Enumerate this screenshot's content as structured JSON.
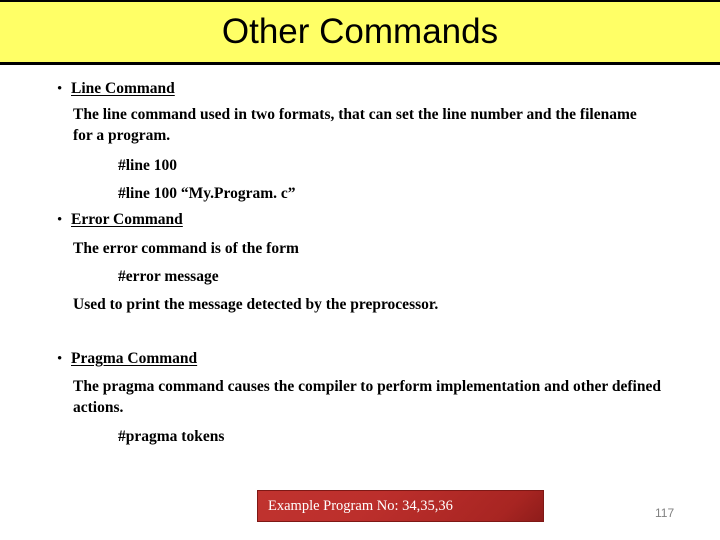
{
  "slide": {
    "title": "Other Commands",
    "page_number": "117",
    "colors": {
      "title_banner_background": "#ffff66",
      "title_banner_border": "#000000",
      "example_banner_background": "#bc2f2c",
      "example_banner_text": "#ffffff",
      "page_number_text": "#808080",
      "body_text": "#000000"
    },
    "bullet_glyph": "•"
  },
  "sections": [
    {
      "heading": "Line Command",
      "description": "The line command used in two formats, that can set the line number and the filename for a program.",
      "code_lines": [
        "#line 100",
        "#line 100 “My.Program. c”"
      ],
      "note": ""
    },
    {
      "heading": "Error Command",
      "description": "The  error command is of the form",
      "code_lines": [
        "#error message"
      ],
      "note": "Used to print the message detected by the preprocessor."
    },
    {
      "heading": "Pragma Command",
      "description": "The pragma command causes the compiler to perform implementation  and other defined actions.",
      "code_lines": [
        "#pragma tokens"
      ],
      "note": ""
    }
  ],
  "example_banner": {
    "label": "Example Program No: 34,35,36"
  }
}
